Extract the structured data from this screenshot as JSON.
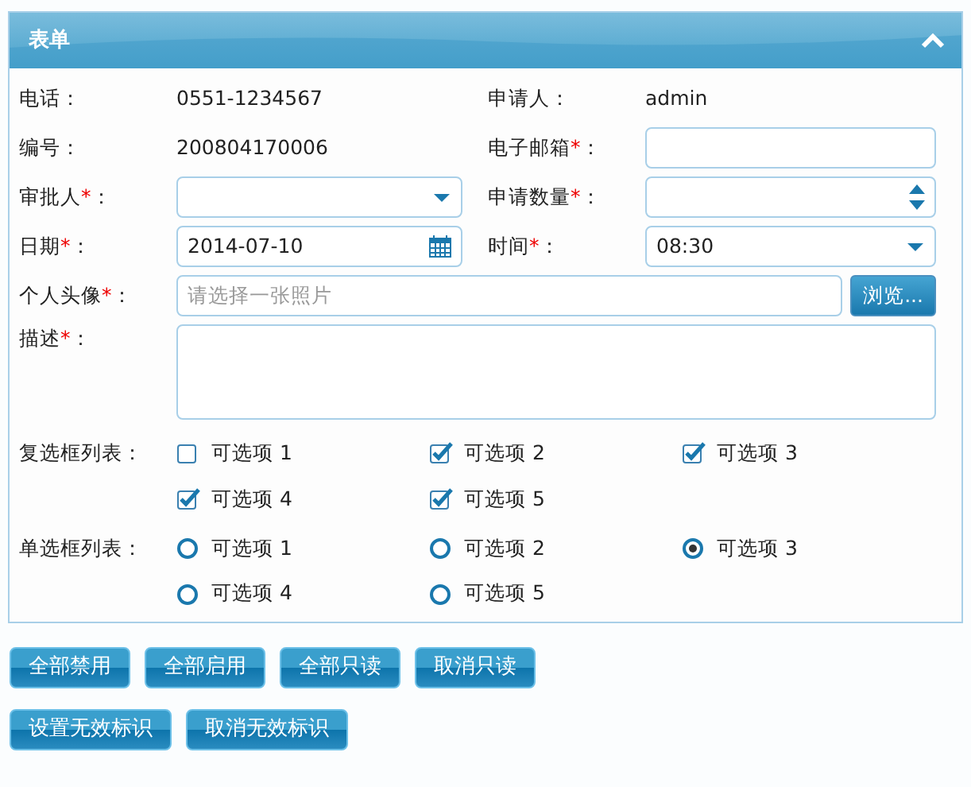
{
  "panel": {
    "title": "表单",
    "collapsed": false
  },
  "fields": [
    {
      "kind": "text",
      "label": "电话",
      "colon": "：",
      "value": "0551-1234567"
    },
    {
      "kind": "text",
      "label": "申请人",
      "colon": "：",
      "value": "admin"
    },
    {
      "kind": "text",
      "label": "编号",
      "colon": "：",
      "value": "200804170006"
    },
    {
      "kind": "input",
      "label": "电子邮箱",
      "asterisk": "*",
      "colon": "："
    },
    {
      "kind": "select",
      "label": "审批人",
      "asterisk": "*",
      "colon": "："
    },
    {
      "kind": "spinner",
      "label": "申请数量",
      "asterisk": "*",
      "colon": "："
    },
    {
      "kind": "date",
      "label": "日期",
      "asterisk": "*",
      "colon": "：",
      "value": "2014-07-10"
    },
    {
      "kind": "select",
      "label": "时间",
      "asterisk": "*",
      "colon": "：",
      "value": "08:30"
    },
    {
      "kind": "file",
      "label": "个人头像",
      "asterisk": "*",
      "colon": "：",
      "placeholder": "请选择一张照片",
      "button": "浏览..."
    },
    {
      "kind": "textarea",
      "label": "描述",
      "asterisk": "*",
      "colon": "："
    }
  ],
  "checkbox_list": {
    "label": "复选框列表",
    "colon": "：",
    "options": [
      {
        "label": "可选项 1",
        "checked": false
      },
      {
        "label": "可选项 2",
        "checked": true
      },
      {
        "label": "可选项 3",
        "checked": true
      },
      {
        "label": "可选项 4",
        "checked": true
      },
      {
        "label": "可选项 5",
        "checked": true
      }
    ]
  },
  "radio_list": {
    "label": "单选框列表",
    "colon": "：",
    "options": [
      {
        "label": "可选项 1",
        "selected": false
      },
      {
        "label": "可选项 2",
        "selected": false
      },
      {
        "label": "可选项 3",
        "selected": true
      },
      {
        "label": "可选项 4",
        "selected": false
      },
      {
        "label": "可选项 5",
        "selected": false
      }
    ]
  },
  "button_rows": [
    [
      "全部禁用",
      "全部启用",
      "全部只读",
      "取消只读"
    ],
    [
      "设置无效标识",
      "取消无效标识"
    ]
  ]
}
